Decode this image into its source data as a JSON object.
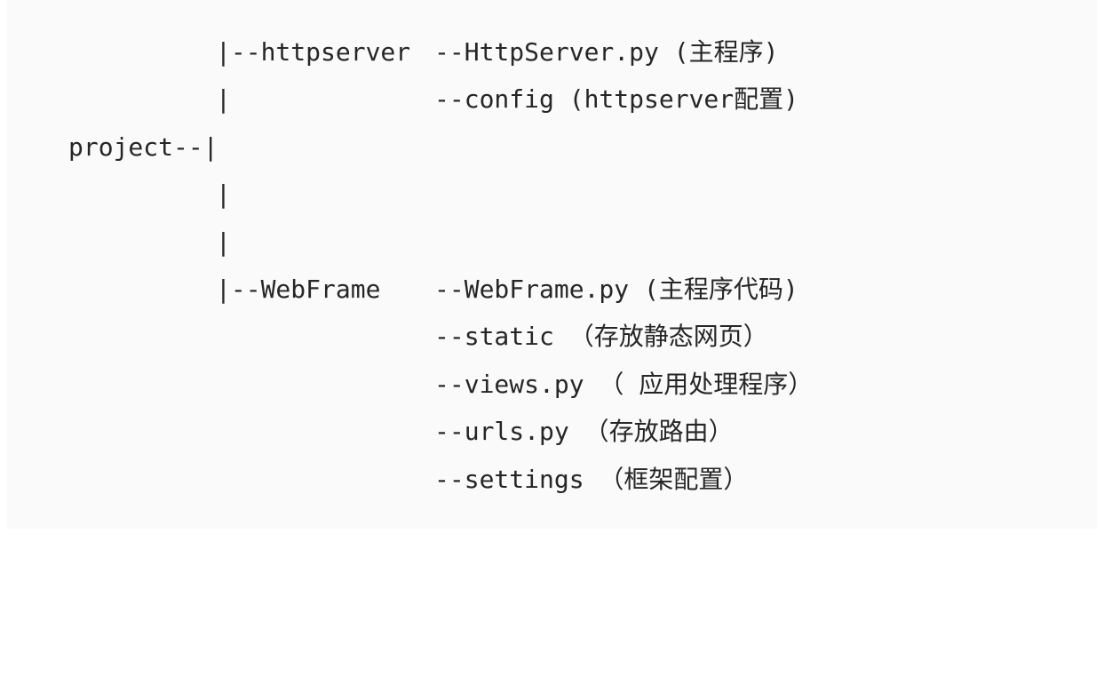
{
  "tree": {
    "lines": [
      {
        "left": "",
        "right": "|--httpserver",
        "file": "--HttpServer.py (主程序)"
      },
      {
        "left": "",
        "right": "|",
        "file": "--config (httpserver配置)"
      },
      {
        "left": "project--|",
        "right": "",
        "file": ""
      },
      {
        "left": "",
        "right": "|",
        "file": ""
      },
      {
        "left": "",
        "right": "|",
        "file": ""
      },
      {
        "left": "",
        "right": "|--WebFrame",
        "file": "--WebFrame.py (主程序代码)"
      },
      {
        "left": "",
        "right": "",
        "file": "--static （存放静态网页）"
      },
      {
        "left": "",
        "right": "",
        "file": "--views.py （ 应用处理程序）"
      },
      {
        "left": "",
        "right": "",
        "file": "--urls.py （存放路由）"
      },
      {
        "left": "",
        "right": "",
        "file": "--settings （框架配置）"
      }
    ]
  }
}
